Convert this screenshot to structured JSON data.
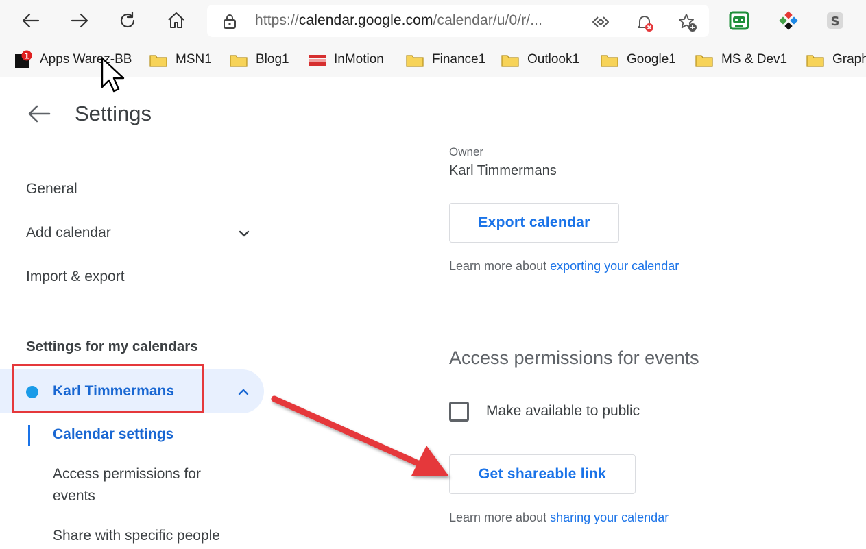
{
  "browser": {
    "url_protocol": "https://",
    "url_host": "calendar.google.com",
    "url_path": "/calendar/u/0/r/..."
  },
  "bookmarks": [
    {
      "label": "Apps Warez-BB",
      "badge": "1"
    },
    {
      "label": "MSN1"
    },
    {
      "label": "Blog1"
    },
    {
      "label": "InMotion"
    },
    {
      "label": "Finance1"
    },
    {
      "label": "Outlook1"
    },
    {
      "label": "Google1"
    },
    {
      "label": "MS & Dev1"
    },
    {
      "label": "Graph"
    }
  ],
  "header": {
    "title": "Settings"
  },
  "sidebar": {
    "items": [
      {
        "label": "General"
      },
      {
        "label": "Add calendar"
      },
      {
        "label": "Import & export"
      }
    ],
    "section_heading": "Settings for my calendars",
    "calendar": {
      "name": "Karl Timmermans",
      "color": "#1a9be8"
    },
    "sub_items": [
      {
        "label": "Calendar settings"
      },
      {
        "label": "Access permissions for events"
      },
      {
        "label": "Share with specific people"
      }
    ]
  },
  "main": {
    "owner_label": "Owner",
    "owner_name": "Karl Timmermans",
    "export_button": "Export calendar",
    "export_learn_prefix": "Learn more about ",
    "export_learn_link": "exporting your calendar",
    "access_title": "Access permissions for events",
    "public_checkbox_label": "Make available to public",
    "public_checked": false,
    "share_button": "Get shareable link",
    "share_learn_prefix": "Learn more about ",
    "share_learn_link": "sharing your calendar"
  },
  "colors": {
    "accent": "#1a73e8",
    "highlight": "#e5383b",
    "selected_bg": "#e8f0fe"
  }
}
